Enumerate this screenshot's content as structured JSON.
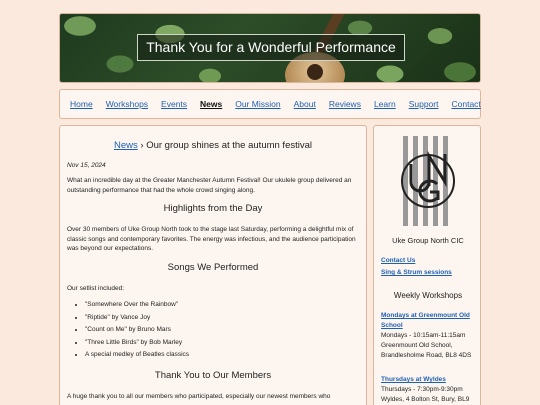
{
  "banner": {
    "title": "Thank You for a Wonderful Performance"
  },
  "nav": {
    "items": [
      {
        "label": "Home"
      },
      {
        "label": "Workshops"
      },
      {
        "label": "Events"
      },
      {
        "label": "News"
      },
      {
        "label": "Our Mission"
      },
      {
        "label": "About"
      },
      {
        "label": "Reviews"
      },
      {
        "label": "Learn"
      },
      {
        "label": "Support"
      },
      {
        "label": "Contact"
      }
    ],
    "active": "News"
  },
  "article": {
    "crumb_link": "News",
    "crumb_sep": " › ",
    "crumb_title": "Our group shines at the autumn festival",
    "date": "Nov 15, 2024",
    "intro": "What an incredible day at the Greater Manchester Autumn Festival! Our ukulele group delivered an outstanding performance that had the whole crowd singing along.",
    "h1": "Highlights from the Day",
    "p1": "Over 30 members of Uke Group North took to the stage last Saturday, performing a delightful mix of classic songs and contemporary favorites. The energy was infectious, and the audience participation was beyond our expectations.",
    "h2": "Songs We Performed",
    "p2": "Our setlist included:",
    "songs": [
      "\"Somewhere Over the Rainbow\"",
      "\"Riptide\" by Vance Joy",
      "\"Count on Me\" by Bruno Mars",
      "\"Three Little Birds\" by Bob Marley",
      "A special medley of Beatles classics"
    ],
    "h3": "Thank You to Our Members",
    "p3": "A huge thank you to all our members who participated, especially our newest members who"
  },
  "sidebar": {
    "org_name": "Uke Group North CIC",
    "contact_us": "Contact Us",
    "sing_strum": "Sing & Strum sessions",
    "workshops_heading": "Weekly Workshops",
    "venues": [
      {
        "title": "Mondays at Greenmount Old School",
        "details": "Mondays - 10:15am-11:15am Greenmount Old School, Brandlesholme Road, BL8 4DS"
      },
      {
        "title": "Thursdays at Wyldes",
        "details": "Thursdays - 7:30pm-9:30pm Wyldes, 4 Bolton St, Bury, BL9"
      }
    ]
  },
  "colors": {
    "link": "#1e5fb3",
    "background": "#fbe9de",
    "panel": "#fdf6f0",
    "border": "#d9b79c"
  }
}
